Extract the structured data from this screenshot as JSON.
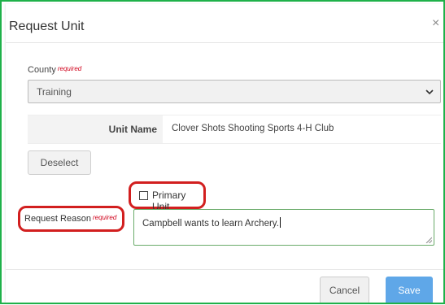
{
  "modal": {
    "title": "Request Unit",
    "close_glyph": "×"
  },
  "county": {
    "label": "County",
    "required_text": "required",
    "selected_value": "Training",
    "chevron_icon": "chevron-down-icon"
  },
  "unit": {
    "label": "Unit Name",
    "value": "Clover Shots Shooting Sports 4-H Club"
  },
  "deselect_label": "Deselect",
  "primary_unit": {
    "label": "Primary Unit",
    "checked": false
  },
  "request_reason": {
    "label": "Request Reason",
    "required_text": "required",
    "value": "Campbell wants to learn Archery."
  },
  "footer": {
    "cancel_label": "Cancel",
    "save_label": "Save"
  },
  "colors": {
    "save_button": "#5fa7e8",
    "required_text": "#d0021b",
    "annotation_outline": "#d21f1f",
    "frame_border": "#1fb14a",
    "textarea_focus_border": "#6aab6a"
  }
}
